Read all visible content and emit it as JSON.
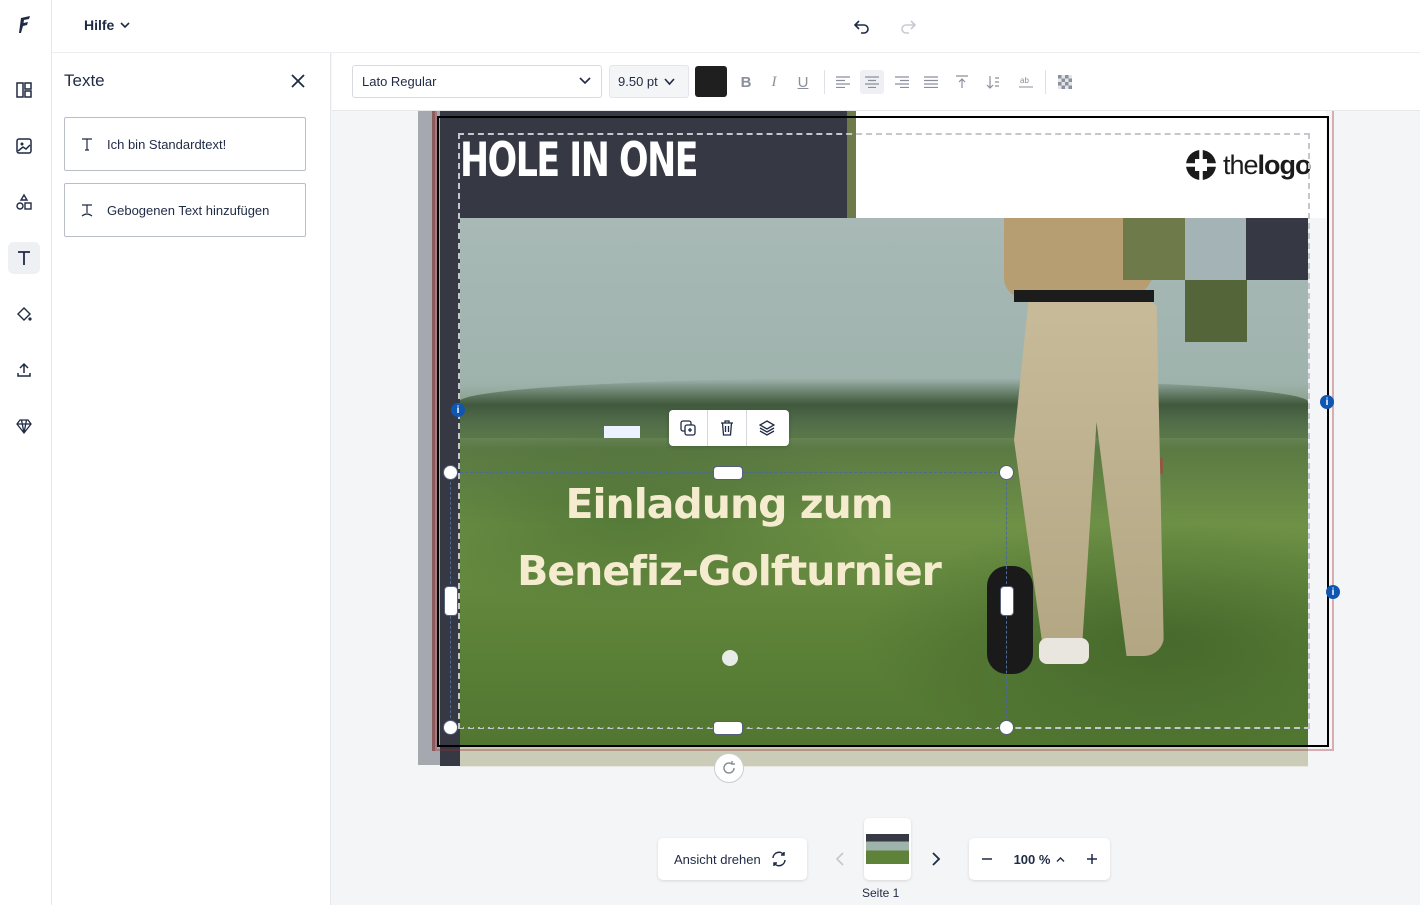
{
  "topbar": {
    "help_label": "Hilfe",
    "undo_icon": "undo-icon",
    "redo_icon": "redo-icon"
  },
  "rail": {
    "items": [
      {
        "name": "layout",
        "icon": "layout-icon"
      },
      {
        "name": "images",
        "icon": "image-icon"
      },
      {
        "name": "shapes",
        "icon": "shapes-icon"
      },
      {
        "name": "texts",
        "icon": "text-icon",
        "active": true
      },
      {
        "name": "background",
        "icon": "paint-bucket-icon"
      },
      {
        "name": "upload",
        "icon": "upload-icon"
      },
      {
        "name": "premium",
        "icon": "diamond-icon"
      }
    ]
  },
  "panel": {
    "title": "Texte",
    "buttons": [
      {
        "label": "Ich bin Standardtext!",
        "icon": "text-icon"
      },
      {
        "label": "Gebogenen Text hinzufügen",
        "icon": "curved-text-icon"
      }
    ]
  },
  "format": {
    "font": "Lato Regular",
    "size": "9.50 pt",
    "color": "#1f1f1f",
    "buttons": [
      "bold",
      "italic",
      "underline",
      "align-left",
      "align-center",
      "align-right",
      "justify",
      "align-top",
      "line-height",
      "letter-spacing",
      "transparency"
    ]
  },
  "design": {
    "headline": "HOLE IN ONE",
    "logo_text_light": "the",
    "logo_text_bold": "logo",
    "body_line1": "Einladung zum",
    "body_line2": "Benefiz-Golfturnier",
    "colors": {
      "dark": "#363844",
      "olive": "#6e7a4a",
      "olive_dark": "#55653a",
      "grey_blue": "#a4b3b5",
      "text": "#f5ecd0"
    }
  },
  "context_menu": {
    "duplicate_icon": "duplicate-icon",
    "delete_icon": "trash-icon",
    "layers_icon": "layers-icon"
  },
  "bottom": {
    "rotate_view_label": "Ansicht drehen",
    "page_label": "Seite 1",
    "zoom_value": "100 %"
  }
}
